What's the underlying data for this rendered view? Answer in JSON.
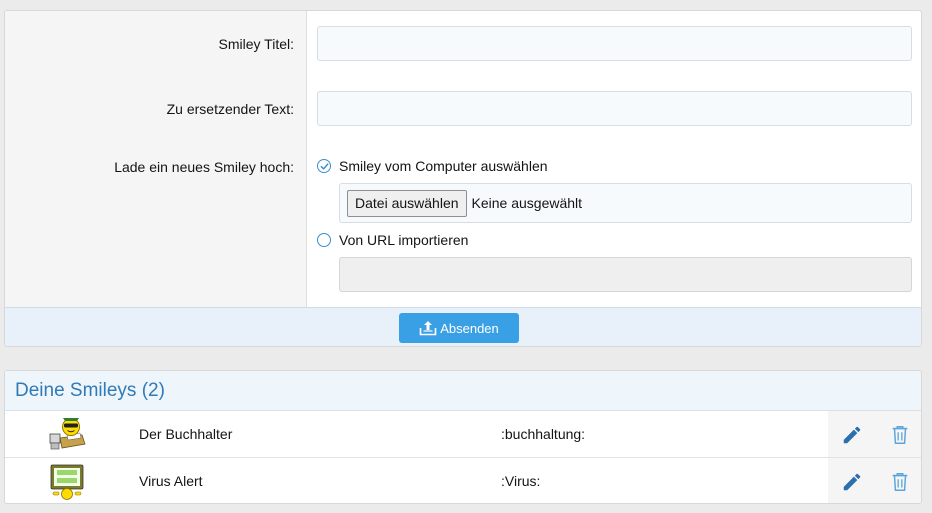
{
  "form": {
    "title_label": "Smiley Titel:",
    "title_value": "",
    "text_label": "Zu ersetzender Text:",
    "text_value": "",
    "upload_label": "Lade ein neues Smiley hoch:",
    "option_computer": "Smiley vom Computer auswählen",
    "option_url": "Von URL importieren",
    "selected_option": "computer",
    "file_button": "Datei auswählen",
    "file_status": "Keine ausgewählt",
    "url_value": "",
    "submit_label": "Absenden"
  },
  "list": {
    "title": "Deine Smileys (2)",
    "rows": [
      {
        "title": "Der Buchhalter",
        "code": ":buchhaltung:",
        "icon": "accountant-smiley-icon"
      },
      {
        "title": "Virus Alert",
        "code": ":Virus:",
        "icon": "virus-alert-smiley-icon"
      }
    ]
  },
  "colors": {
    "accent": "#3aa0e6",
    "heading": "#2f7ab8",
    "radio": "#3a8fd1"
  }
}
